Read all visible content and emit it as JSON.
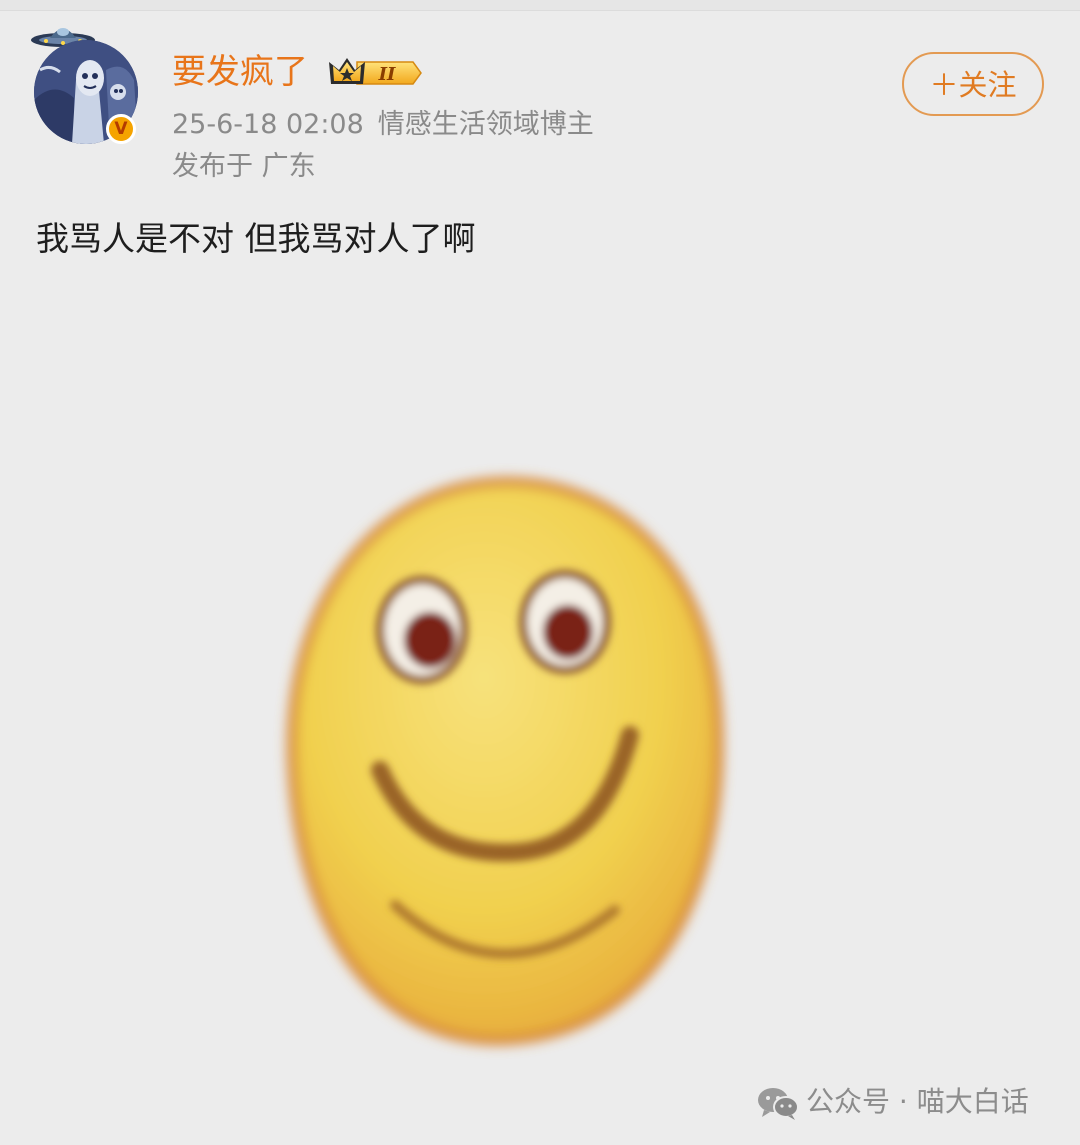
{
  "post": {
    "author": {
      "name": "要发疯了",
      "badge_level": "II",
      "verified_mark": "V",
      "avatar_icon": "ufo-alien-avatar"
    },
    "timestamp": "25-6-18 02:08",
    "category": "情感生活领域博主",
    "location": "发布于 广东",
    "follow_label": "＋关注",
    "text": "我骂人是不对 但我骂对人了啊",
    "image": "smiley-face-emoji"
  },
  "watermark": {
    "icon": "wechat-icon",
    "text": "公众号 · 喵大白话"
  },
  "colors": {
    "username": "#e8751a",
    "follow_border": "#e39a52",
    "meta_text": "#8a8a8a",
    "background": "#ececec"
  }
}
